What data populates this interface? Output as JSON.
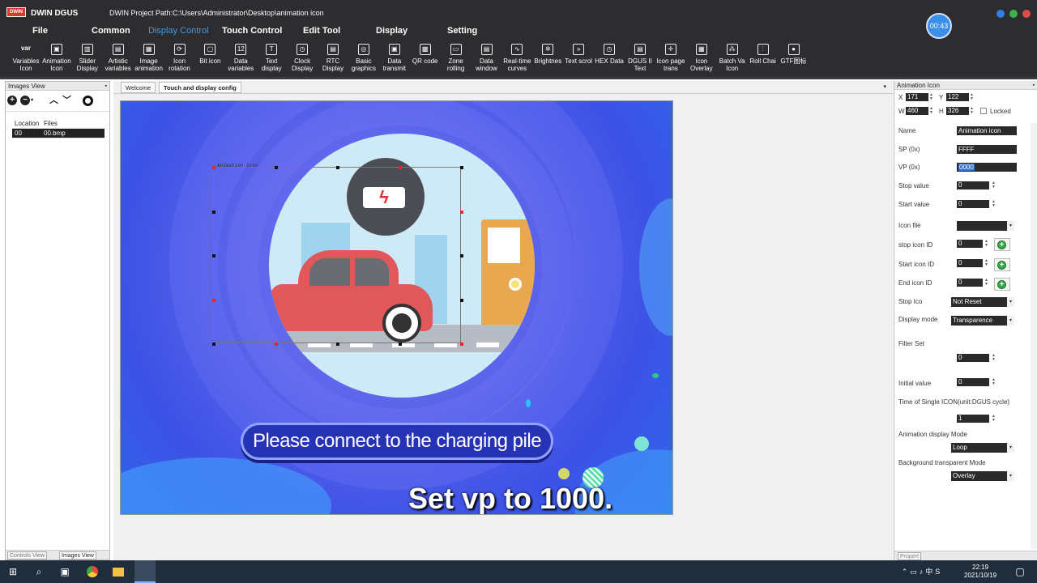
{
  "titlebar": {
    "logo": "DWIN",
    "app_name": "DWIN DGUS",
    "project_path": "DWIN Project Path:C:\\Users\\Administrator\\Desktop\\animation icon",
    "timer": "00:43"
  },
  "menu": [
    "File",
    "Common",
    "Display Control",
    "Touch Control",
    "Edit Tool",
    "Display",
    "Setting"
  ],
  "menu_active": "Display Control",
  "colors": {
    "menu_active": "#3d9be9",
    "canvas_bg": "#4a5ce8",
    "chrome": "#2d2d30"
  },
  "toolbar": [
    {
      "label": "Variables Icon",
      "icon": "var-icon",
      "glyph": "var"
    },
    {
      "label": "Animation Icon",
      "icon": "animation-icon",
      "glyph": "▣"
    },
    {
      "label": "Slider Display",
      "icon": "slider-icon",
      "glyph": "▥"
    },
    {
      "label": "Artistic variables",
      "icon": "artistic-icon",
      "glyph": "▤"
    },
    {
      "label": "Image animation",
      "icon": "image-icon",
      "glyph": "▦"
    },
    {
      "label": "Icon rotation",
      "icon": "rotation-icon",
      "glyph": "⟳"
    },
    {
      "label": "Bit icon",
      "icon": "bit-icon",
      "glyph": "▢"
    },
    {
      "label": "Data variables",
      "icon": "data-icon",
      "glyph": "12"
    },
    {
      "label": "Text display",
      "icon": "text-icon",
      "glyph": "T"
    },
    {
      "label": "Clock Display",
      "icon": "clock-icon",
      "glyph": "◷"
    },
    {
      "label": "RTC Display",
      "icon": "rtc-icon",
      "glyph": "▤"
    },
    {
      "label": "Basic graphics",
      "icon": "graphics-icon",
      "glyph": "◎"
    },
    {
      "label": "Data transmit",
      "icon": "transmit-icon",
      "glyph": "▣"
    },
    {
      "label": "QR code",
      "icon": "qr-icon",
      "glyph": "▩"
    },
    {
      "label": "Zone rolling",
      "icon": "zone-icon",
      "glyph": "▭"
    },
    {
      "label": "Data window",
      "icon": "window-icon",
      "glyph": "▤"
    },
    {
      "label": "Real-time curves",
      "icon": "curve-icon",
      "glyph": "∿"
    },
    {
      "label": "Brightnes",
      "icon": "brightness-icon",
      "glyph": "✲"
    },
    {
      "label": "Text scrol",
      "icon": "scroll-icon",
      "glyph": "»"
    },
    {
      "label": "HEX Data",
      "icon": "hex-icon",
      "glyph": "◷"
    },
    {
      "label": "DGUS II Text",
      "icon": "dgus-text-icon",
      "glyph": "▤"
    },
    {
      "label": "Icon page trans",
      "icon": "page-trans-icon",
      "glyph": "✛"
    },
    {
      "label": "Icon Overlay",
      "icon": "overlay-icon",
      "glyph": "▦"
    },
    {
      "label": "Batch Va Icon",
      "icon": "batch-icon",
      "glyph": "⁂"
    },
    {
      "label": "Roll Chai",
      "icon": "roll-icon",
      "glyph": "⫶"
    },
    {
      "label": "GTF图标",
      "icon": "gtf-icon",
      "glyph": "●"
    }
  ],
  "left_panel": {
    "title": "Images View",
    "headers": [
      "Location",
      "Files"
    ],
    "rows": [
      {
        "location": "00",
        "file": "00.bmp"
      }
    ],
    "bottom_tabs": [
      "Controls View",
      "Images View"
    ]
  },
  "doc_tabs": [
    "Welcome",
    "Touch and display config"
  ],
  "canvas": {
    "selection_name": "Animation icon",
    "banner": "Please connect to the charging pile",
    "subtitle": "Set vp to 1000."
  },
  "right_panel": {
    "title": "Animation Icon",
    "x_label": "X",
    "x": "171",
    "y_label": "Y",
    "y": "122",
    "w_label": "W",
    "w": "460",
    "h_label": "H",
    "h": "326",
    "locked_label": "Locked",
    "name_label": "Name",
    "name": "Animation icon",
    "sp_label": "SP (0x)",
    "sp": "FFFF",
    "vp_label": "VP (0x)",
    "vp": "0000",
    "stop_value_label": "Stop value",
    "stop_value": "0",
    "start_value_label": "Start value",
    "start_value": "0",
    "icon_file_label": "Icon file",
    "icon_file": "",
    "stop_icon_label": "stop icon ID",
    "stop_icon": "0",
    "start_icon_label": "Start icon ID",
    "start_icon": "0",
    "end_icon_label": "End icon ID",
    "end_icon": "0",
    "stop_ico_label": "Stop Ico",
    "stop_ico": "Not Reset",
    "display_mode_label": "Display mode",
    "display_mode": "Transparence",
    "filter_label": "Filter Set",
    "filter": "0",
    "initial_label": "Initial value",
    "initial": "0",
    "time_label": "Time of Single ICON(unit:DGUS cycle)",
    "time": "1",
    "anim_mode_label": "Animation display Mode",
    "anim_mode": "Loop",
    "bg_mode_label": "Background transparent Mode",
    "bg_mode": "Overlay",
    "bottom_tab": "Propert"
  },
  "taskbar": {
    "time": "22:19",
    "date": "2021/10/19",
    "ime": "中"
  }
}
